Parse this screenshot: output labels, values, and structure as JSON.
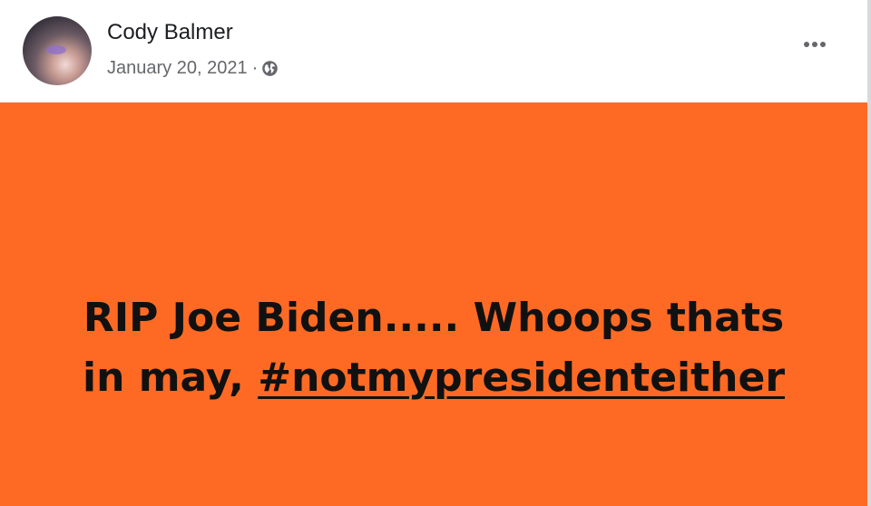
{
  "post": {
    "author": "Cody Balmer",
    "date": "January 20, 2021",
    "separator": "·",
    "privacy_icon": "globe-icon",
    "more_icon": "ellipsis-icon"
  },
  "status": {
    "line1": "RIP Joe Biden..... Whoops thats",
    "line2_prefix": "in may, ",
    "hashtag": "#notmypresidenteither",
    "background_color": "#fe6a24",
    "text_color": "#111111"
  }
}
